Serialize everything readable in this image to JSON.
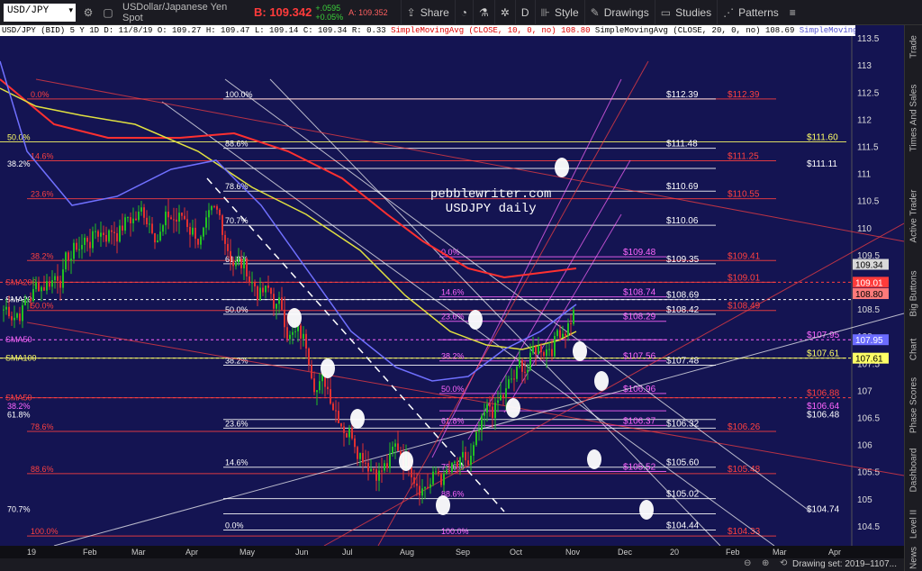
{
  "toolbar": {
    "symbol": "USD/JPY",
    "description": "USDollar/Japanese Yen Spot",
    "bid_main": "B: 109.342",
    "change1": "+.0595",
    "change2": "+0.05%",
    "ask": "A: 109.352",
    "share": "Share",
    "interval": "D",
    "style": "Style",
    "drawings": "Drawings",
    "studies": "Studies",
    "patterns": "Patterns"
  },
  "studybar": {
    "ohlc": "USD/JPY (BID) 5 Y 1D  D: 11/8/19  O: 109.27  H: 109.47  L: 109.14  C: 109.34  R: 0.33",
    "sma10": "SimpleMovingAvg (CLOSE, 10, 0, no)  108.80",
    "sma20": "SimpleMovingAvg (CLOSE, 20, 0, no)  108.69",
    "sma50": "SimpleMovingAvg..."
  },
  "watermark": [
    "pebblewriter.com",
    "USDJPY daily"
  ],
  "price_axis": [
    "113.5",
    "113",
    "112.5",
    "112",
    "111.5",
    "111",
    "110.5",
    "110",
    "109.5",
    "109",
    "108.5",
    "108",
    "107.5",
    "107",
    "106.5",
    "106",
    "105.5",
    "105",
    "104.5"
  ],
  "price_tags": [
    {
      "label": "109.34",
      "bg": "#d8d8d8",
      "fg": "#000",
      "price": 109.34
    },
    {
      "label": "109.01",
      "bg": "#ff3b3b",
      "fg": "#fff",
      "price": 109.01
    },
    {
      "label": "108.80",
      "bg": "#ff7a7a",
      "fg": "#000",
      "price": 108.8
    },
    {
      "label": "107.95",
      "bg": "#6b6bff",
      "fg": "#fff",
      "price": 107.95
    },
    {
      "label": "107.61",
      "bg": "#ffff66",
      "fg": "#000",
      "price": 107.61
    }
  ],
  "levels": [
    {
      "label": "$112.39",
      "price": 112.39,
      "color": "#ff4040"
    },
    {
      "label": "$112.39",
      "price": 112.39,
      "color": "#ffffff"
    },
    {
      "label": "$111.60",
      "price": 111.6,
      "color": "#ffff66"
    },
    {
      "label": "$111.48",
      "price": 111.48,
      "color": "#ffffff"
    },
    {
      "label": "$111.25",
      "price": 111.25,
      "color": "#ff4040"
    },
    {
      "label": "$111.11",
      "price": 111.11,
      "color": "#ffffff"
    },
    {
      "label": "$110.69",
      "price": 110.69,
      "color": "#ffffff"
    },
    {
      "label": "$110.55",
      "price": 110.55,
      "color": "#ff4040"
    },
    {
      "label": "$110.06",
      "price": 110.06,
      "color": "#ffffff"
    },
    {
      "label": "$109.48",
      "price": 109.48,
      "color": "#ff66ff"
    },
    {
      "label": "$109.41",
      "price": 109.41,
      "color": "#ff4040"
    },
    {
      "label": "$109.35",
      "price": 109.35,
      "color": "#ffffff"
    },
    {
      "label": "$109.01",
      "price": 109.01,
      "color": "#ff4040"
    },
    {
      "label": "$108.74",
      "price": 108.74,
      "color": "#ff66ff"
    },
    {
      "label": "$108.69",
      "price": 108.69,
      "color": "#ffffff"
    },
    {
      "label": "$108.49",
      "price": 108.49,
      "color": "#ff4040"
    },
    {
      "label": "$108.42",
      "price": 108.42,
      "color": "#ffffff"
    },
    {
      "label": "$108.29",
      "price": 108.29,
      "color": "#ff66ff"
    },
    {
      "label": "$107.95",
      "price": 107.95,
      "color": "#ff66ff"
    },
    {
      "label": "$107.61",
      "price": 107.61,
      "color": "#ffff66"
    },
    {
      "label": "$107.56",
      "price": 107.56,
      "color": "#ff66ff"
    },
    {
      "label": "$107.48",
      "price": 107.48,
      "color": "#ffffff"
    },
    {
      "label": "$106.96",
      "price": 106.96,
      "color": "#ff66ff"
    },
    {
      "label": "$106.88",
      "price": 106.88,
      "color": "#ff4040"
    },
    {
      "label": "$106.64",
      "price": 106.64,
      "color": "#ff66ff"
    },
    {
      "label": "$106.48",
      "price": 106.48,
      "color": "#ffffff"
    },
    {
      "label": "$106.37",
      "price": 106.37,
      "color": "#ff66ff"
    },
    {
      "label": "$106.32",
      "price": 106.32,
      "color": "#ffffff"
    },
    {
      "label": "$106.26",
      "price": 106.26,
      "color": "#ff4040"
    },
    {
      "label": "$105.60",
      "price": 105.6,
      "color": "#ffffff"
    },
    {
      "label": "$105.52",
      "price": 105.52,
      "color": "#ff66ff"
    },
    {
      "label": "$105.48",
      "price": 105.48,
      "color": "#ff4040"
    },
    {
      "label": "$105.02",
      "price": 105.02,
      "color": "#ffffff"
    },
    {
      "label": "$104.74",
      "price": 104.74,
      "color": "#ffffff"
    },
    {
      "label": "$104.44",
      "price": 104.44,
      "color": "#ffffff"
    },
    {
      "label": "$104.33",
      "price": 104.33,
      "color": "#ff4040"
    }
  ],
  "fib_labels": [
    {
      "label": "0.0%",
      "price": 112.39,
      "color": "#ff4040"
    },
    {
      "label": "100.0%",
      "price": 112.39,
      "color": "#ffffff"
    },
    {
      "label": "50.0%",
      "price": 111.6,
      "color": "#ffff66"
    },
    {
      "label": "88.6%",
      "price": 111.48,
      "color": "#ffffff"
    },
    {
      "label": "14.6%",
      "price": 111.25,
      "color": "#ff4040"
    },
    {
      "label": "38.2%",
      "price": 111.11,
      "color": "#ffffff"
    },
    {
      "label": "78.6%",
      "price": 110.69,
      "color": "#ffffff"
    },
    {
      "label": "23.6%",
      "price": 110.55,
      "color": "#ff4040"
    },
    {
      "label": "70.7%",
      "price": 110.06,
      "color": "#ffffff"
    },
    {
      "label": "0.0%",
      "price": 109.48,
      "color": "#ff66ff"
    },
    {
      "label": "38.2%",
      "price": 109.41,
      "color": "#ff4040"
    },
    {
      "label": "61.8%",
      "price": 109.35,
      "color": "#ffffff"
    },
    {
      "label": "14.6%",
      "price": 108.74,
      "color": "#ff66ff"
    },
    {
      "label": "50.0%",
      "price": 108.49,
      "color": "#ff4040"
    },
    {
      "label": "50.0%",
      "price": 108.42,
      "color": "#ffffff"
    },
    {
      "label": "23.6%",
      "price": 108.29,
      "color": "#ff66ff"
    },
    {
      "label": "38.2%",
      "price": 107.56,
      "color": "#ff66ff"
    },
    {
      "label": "38.2%",
      "price": 107.48,
      "color": "#ffffff"
    },
    {
      "label": "50.0%",
      "price": 106.96,
      "color": "#ff66ff"
    },
    {
      "label": "38.2%",
      "price": 106.64,
      "color": "#ff66ff"
    },
    {
      "label": "61.8%",
      "price": 106.48,
      "color": "#ffffff"
    },
    {
      "label": "61.8%",
      "price": 106.37,
      "color": "#ff66ff"
    },
    {
      "label": "23.6%",
      "price": 106.32,
      "color": "#ffffff"
    },
    {
      "label": "78.6%",
      "price": 106.26,
      "color": "#ff4040"
    },
    {
      "label": "14.6%",
      "price": 105.6,
      "color": "#ffffff"
    },
    {
      "label": "78.6%",
      "price": 105.52,
      "color": "#ff66ff"
    },
    {
      "label": "88.6%",
      "price": 105.48,
      "color": "#ff4040"
    },
    {
      "label": "88.6%",
      "price": 105.02,
      "color": "#ff66ff"
    },
    {
      "label": "70.7%",
      "price": 104.74,
      "color": "#ffffff"
    },
    {
      "label": "0.0%",
      "price": 104.44,
      "color": "#ffffff"
    },
    {
      "label": "100.0%",
      "price": 104.33,
      "color": "#ff4040"
    },
    {
      "label": "100.0%",
      "price": 104.33,
      "color": "#ff66ff"
    }
  ],
  "left_tags": [
    {
      "label": "SMA200",
      "price": 109.01,
      "color": "#ff4040"
    },
    {
      "label": "SMA20",
      "price": 108.69,
      "color": "#ffffff"
    },
    {
      "label": "SMA50",
      "price": 107.95,
      "color": "#ff66ff"
    },
    {
      "label": "SMA100",
      "price": 107.61,
      "color": "#ffff66"
    },
    {
      "label": "SMA50",
      "price": 106.88,
      "color": "#ff4040"
    }
  ],
  "time_axis": [
    "19",
    "Feb",
    "Mar",
    "Apr",
    "May",
    "Jun",
    "Jul",
    "Aug",
    "Sep",
    "Oct",
    "Nov",
    "Dec",
    "20",
    "Feb",
    "Mar",
    "Apr"
  ],
  "sidetabs": [
    "Trade",
    "Times And Sales",
    "Active Trader",
    "Big Buttons",
    "Chart",
    "Phase Scores",
    "Dashboard",
    "Level II",
    "Live News"
  ],
  "drawing_set": "Drawing set: 2019–1107..."
}
